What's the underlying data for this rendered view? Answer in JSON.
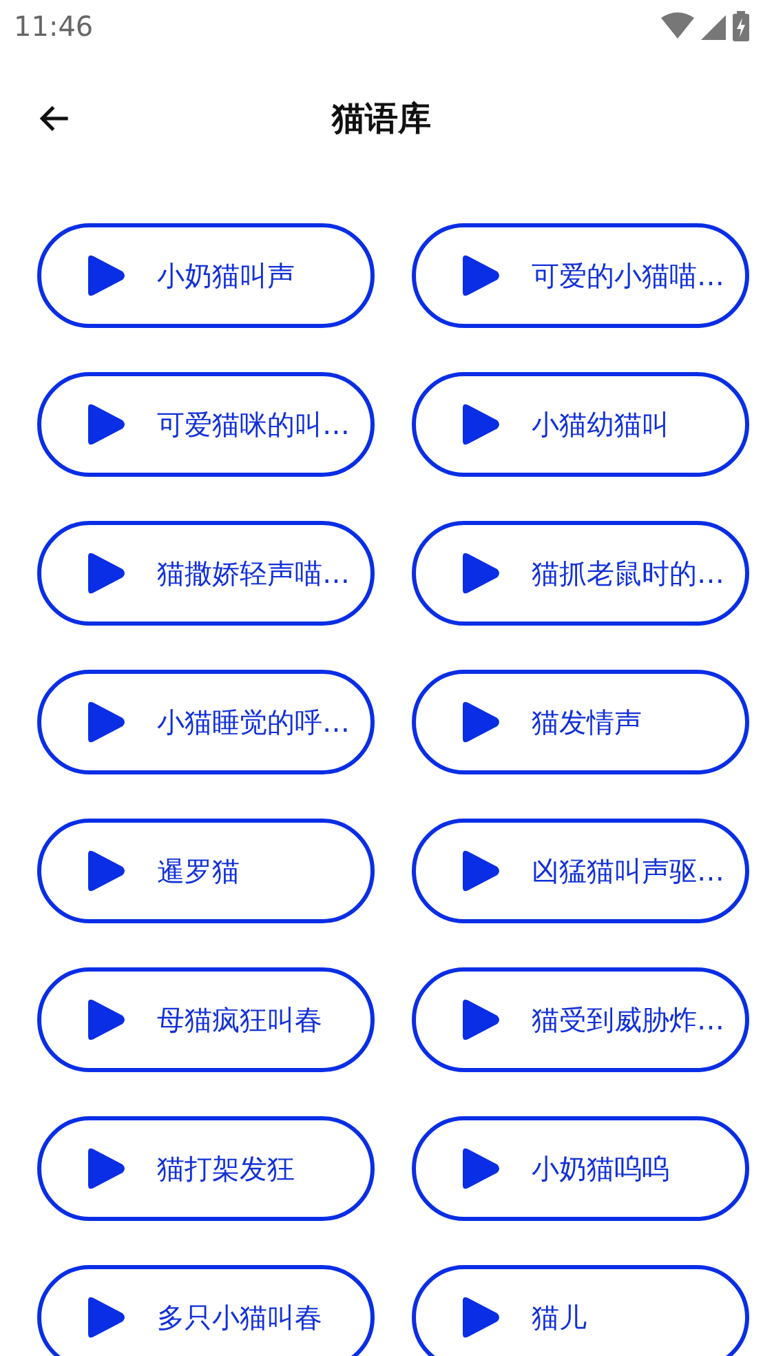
{
  "status_bar": {
    "time": "11:46"
  },
  "app_bar": {
    "title": "猫语库"
  },
  "sounds": [
    {
      "label": "小奶猫叫声"
    },
    {
      "label": "可爱的小猫喵…"
    },
    {
      "label": "可爱猫咪的叫…"
    },
    {
      "label": "小猫幼猫叫"
    },
    {
      "label": "猫撒娇轻声喵…"
    },
    {
      "label": "猫抓老鼠时的…"
    },
    {
      "label": "小猫睡觉的呼…"
    },
    {
      "label": "猫发情声"
    },
    {
      "label": "暹罗猫"
    },
    {
      "label": "凶猛猫叫声驱…"
    },
    {
      "label": "母猫疯狂叫春"
    },
    {
      "label": "猫受到威胁炸…"
    },
    {
      "label": "猫打架发狂"
    },
    {
      "label": "小奶猫呜呜"
    },
    {
      "label": "多只小猫叫春"
    },
    {
      "label": "猫儿"
    }
  ]
}
